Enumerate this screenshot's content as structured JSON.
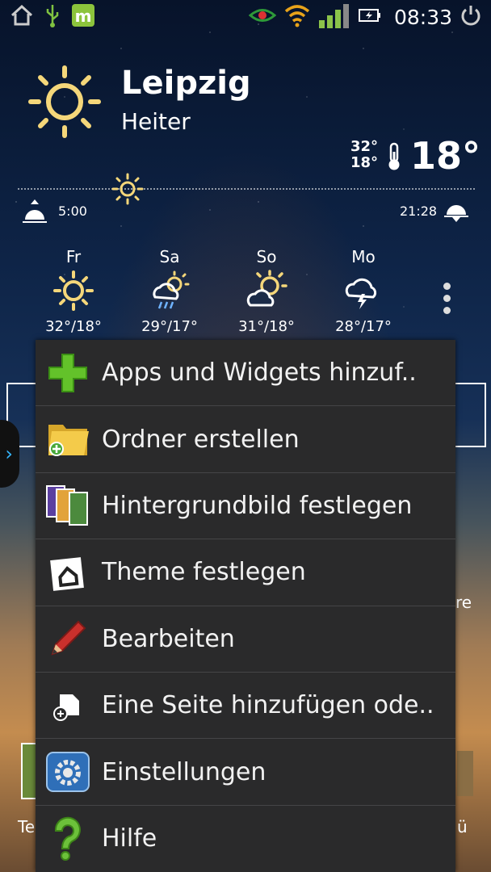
{
  "status_bar": {
    "time": "08:33",
    "left_icons": [
      "home-icon",
      "usb-icon",
      "app-m-icon"
    ],
    "right_icons": [
      "eye-icon",
      "wifi-icon",
      "signal-icon",
      "battery-icon",
      "power-icon"
    ]
  },
  "weather": {
    "city": "Leipzig",
    "condition": "Heiter",
    "high": "32°",
    "low": "18°",
    "current_temp": "18°",
    "sunrise": "5:00",
    "sunset": "21:28",
    "forecast": [
      {
        "day": "Fr",
        "temp": "32°/18°",
        "icon": "sun-icon"
      },
      {
        "day": "Sa",
        "temp": "29°/17°",
        "icon": "sun-rain-icon"
      },
      {
        "day": "So",
        "temp": "31°/18°",
        "icon": "sun-cloud-icon"
      },
      {
        "day": "Mo",
        "temp": "28°/17°",
        "icon": "thunder-cloud-icon"
      }
    ]
  },
  "background": {
    "right_text": "re",
    "left_dock_label": "Te",
    "right_dock_label": "ü"
  },
  "menu": {
    "items": [
      {
        "label": "Apps und Widgets hinzuf..",
        "icon": "plus-icon"
      },
      {
        "label": "Ordner erstellen",
        "icon": "folder-add-icon"
      },
      {
        "label": "Hintergrundbild festlegen",
        "icon": "wallpaper-icon"
      },
      {
        "label": "Theme festlegen",
        "icon": "theme-icon"
      },
      {
        "label": "Bearbeiten",
        "icon": "pencil-icon"
      },
      {
        "label": "Eine Seite hinzufügen ode..",
        "icon": "page-add-icon"
      },
      {
        "label": "Einstellungen",
        "icon": "settings-icon"
      },
      {
        "label": "Hilfe",
        "icon": "help-icon"
      }
    ]
  }
}
